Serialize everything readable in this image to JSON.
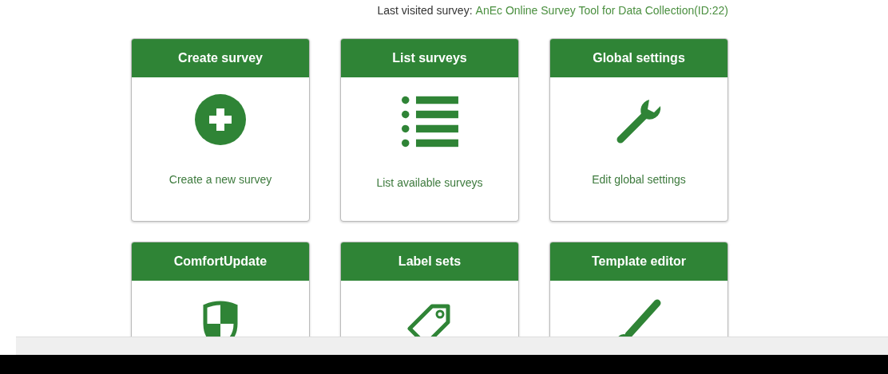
{
  "last_visited": {
    "label": "Last visited survey:",
    "link": "AnEc Online Survey Tool for Data Collection(ID:22)"
  },
  "cards": [
    {
      "title": "Create survey",
      "description": "Create a new survey"
    },
    {
      "title": "List surveys",
      "description": "List available surveys"
    },
    {
      "title": "Global settings",
      "description": "Edit global settings"
    },
    {
      "title": "ComfortUpdate"
    },
    {
      "title": "Label sets"
    },
    {
      "title": "Template editor"
    }
  ]
}
